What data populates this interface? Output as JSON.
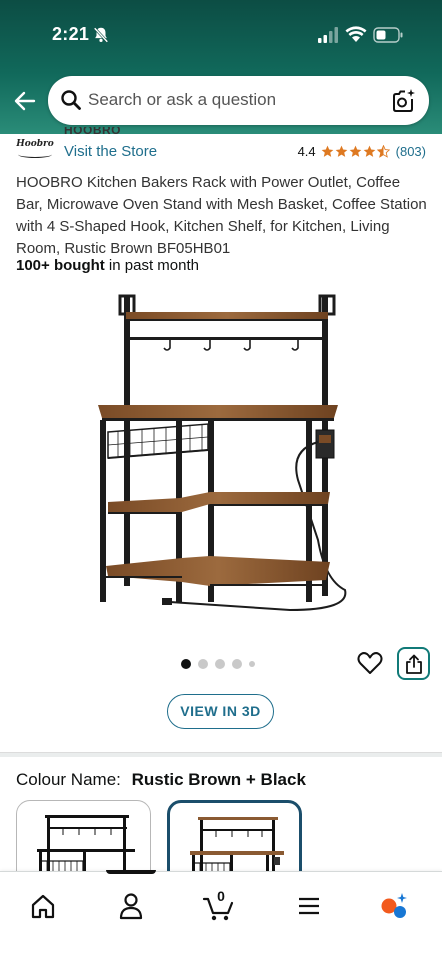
{
  "status_bar": {
    "time": "2:21",
    "icons": [
      "bell-off-icon",
      "signal-icon",
      "wifi-icon",
      "battery-icon"
    ]
  },
  "search": {
    "placeholder": "Search or ask a question",
    "icons": [
      "back-arrow-icon",
      "search-icon",
      "camera-search-icon"
    ]
  },
  "brand": {
    "logo_text": "Hoobro",
    "name": "HOOBRO",
    "visit_store": "Visit the Store"
  },
  "rating": {
    "value": "4.4",
    "stars": 4.5,
    "count": "(803)",
    "star_color": "#de7921"
  },
  "product": {
    "title": "HOOBRO Kitchen Bakers Rack with Power Outlet, Coffee Bar, Microwave Oven Stand with Mesh Basket, Coffee Station with 4 S-Shaped Hook, Kitchen Shelf, for Kitchen, Living Room, Rustic Brown BF05HB01",
    "bought_bold": "100+ bought",
    "bought_rest": " in past month"
  },
  "gallery": {
    "image_count": 5,
    "active_index": 0,
    "view_3d_label": "VIEW IN 3D"
  },
  "colour": {
    "label": "Colour Name:",
    "selected": "Rustic Brown + Black",
    "options": [
      {
        "name": "Black",
        "selected": false
      },
      {
        "name": "Rustic Brown + Black",
        "selected": true
      }
    ]
  },
  "bottom_nav": {
    "items": [
      "home-icon",
      "account-icon",
      "cart-icon",
      "menu-icon",
      "rufus-assistant-icon"
    ],
    "active_index": 1,
    "cart_count": "0"
  },
  "colors": {
    "header_top": "#0c4d44",
    "header_bottom": "#2a8c78",
    "link": "#1f6e8c",
    "star": "#de7921",
    "wood": "#8a5a32",
    "selected_border": "#1b4e6b"
  }
}
